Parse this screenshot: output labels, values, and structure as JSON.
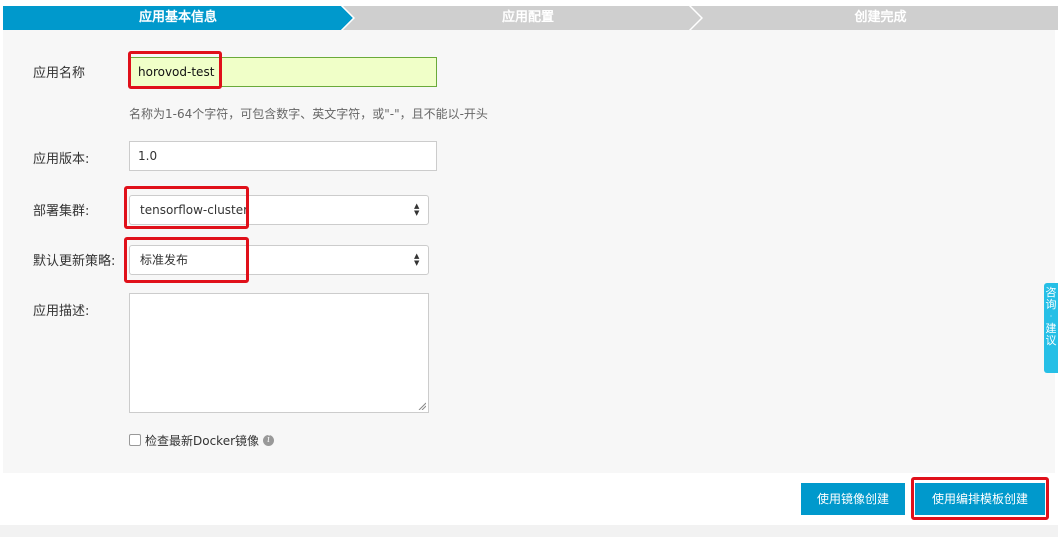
{
  "wizard": {
    "steps": [
      {
        "label": "应用基本信息",
        "active": true
      },
      {
        "label": "应用配置",
        "active": false
      },
      {
        "label": "创建完成",
        "active": false
      }
    ],
    "active_color": "#0099cc",
    "inactive_color": "#cfcfcf"
  },
  "form": {
    "app_name": {
      "label": "应用名称",
      "value": "horovod-test"
    },
    "hint": "名称为1-64个字符，可包含数字、英文字符，或\"-\"，且不能以-开头",
    "app_version": {
      "label": "应用版本:",
      "value": "1.0"
    },
    "cluster": {
      "label": "部署集群:",
      "value": "tensorflow-cluster"
    },
    "strategy": {
      "label": "默认更新策略:",
      "value": "标准发布"
    },
    "description": {
      "label": "应用描述:",
      "value": ""
    },
    "check_docker": {
      "label": "检查最新Docker镜像",
      "checked": false
    }
  },
  "buttons": {
    "create_with_image": "使用镜像创建",
    "create_with_template": "使用编排模板创建"
  },
  "feedback_tab": {
    "line1": "咨询",
    "line2": "建议"
  },
  "highlight_color": "#e0101a"
}
